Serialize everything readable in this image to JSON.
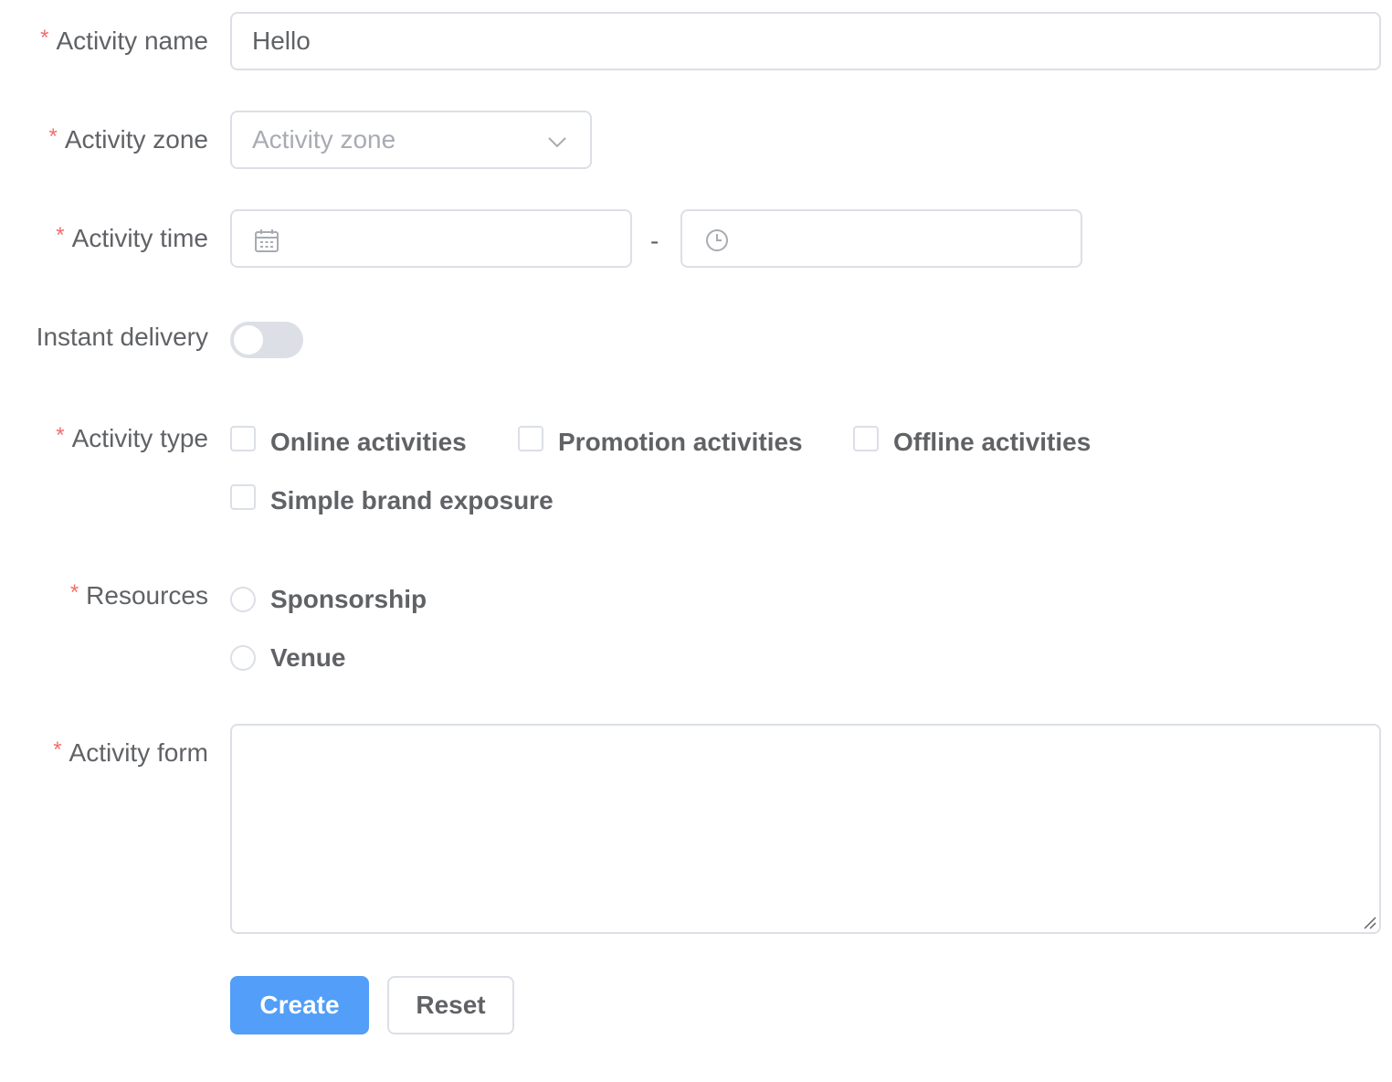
{
  "form": {
    "activity_name": {
      "label": "Activity name",
      "required": true,
      "value": "Hello"
    },
    "activity_zone": {
      "label": "Activity zone",
      "required": true,
      "placeholder": "Activity zone"
    },
    "activity_time": {
      "label": "Activity time",
      "required": true,
      "separator": "-",
      "date_icon": "calendar-icon",
      "time_icon": "clock-icon"
    },
    "instant_delivery": {
      "label": "Instant delivery",
      "required": false,
      "on": false
    },
    "activity_type": {
      "label": "Activity type",
      "required": true,
      "options": [
        {
          "label": "Online activities",
          "checked": false
        },
        {
          "label": "Promotion activities",
          "checked": false
        },
        {
          "label": "Offline activities",
          "checked": false
        },
        {
          "label": "Simple brand exposure",
          "checked": false
        }
      ]
    },
    "resources": {
      "label": "Resources",
      "required": true,
      "options": [
        {
          "label": "Sponsorship",
          "selected": false
        },
        {
          "label": "Venue",
          "selected": false
        }
      ]
    },
    "activity_form": {
      "label": "Activity form",
      "required": true,
      "value": ""
    },
    "buttons": {
      "create": "Create",
      "reset": "Reset"
    }
  },
  "colors": {
    "primary": "#529ef8",
    "required_asterisk": "#f56c6c",
    "border": "#dcdfe6",
    "text": "#606266",
    "placeholder": "#a8abb2"
  }
}
